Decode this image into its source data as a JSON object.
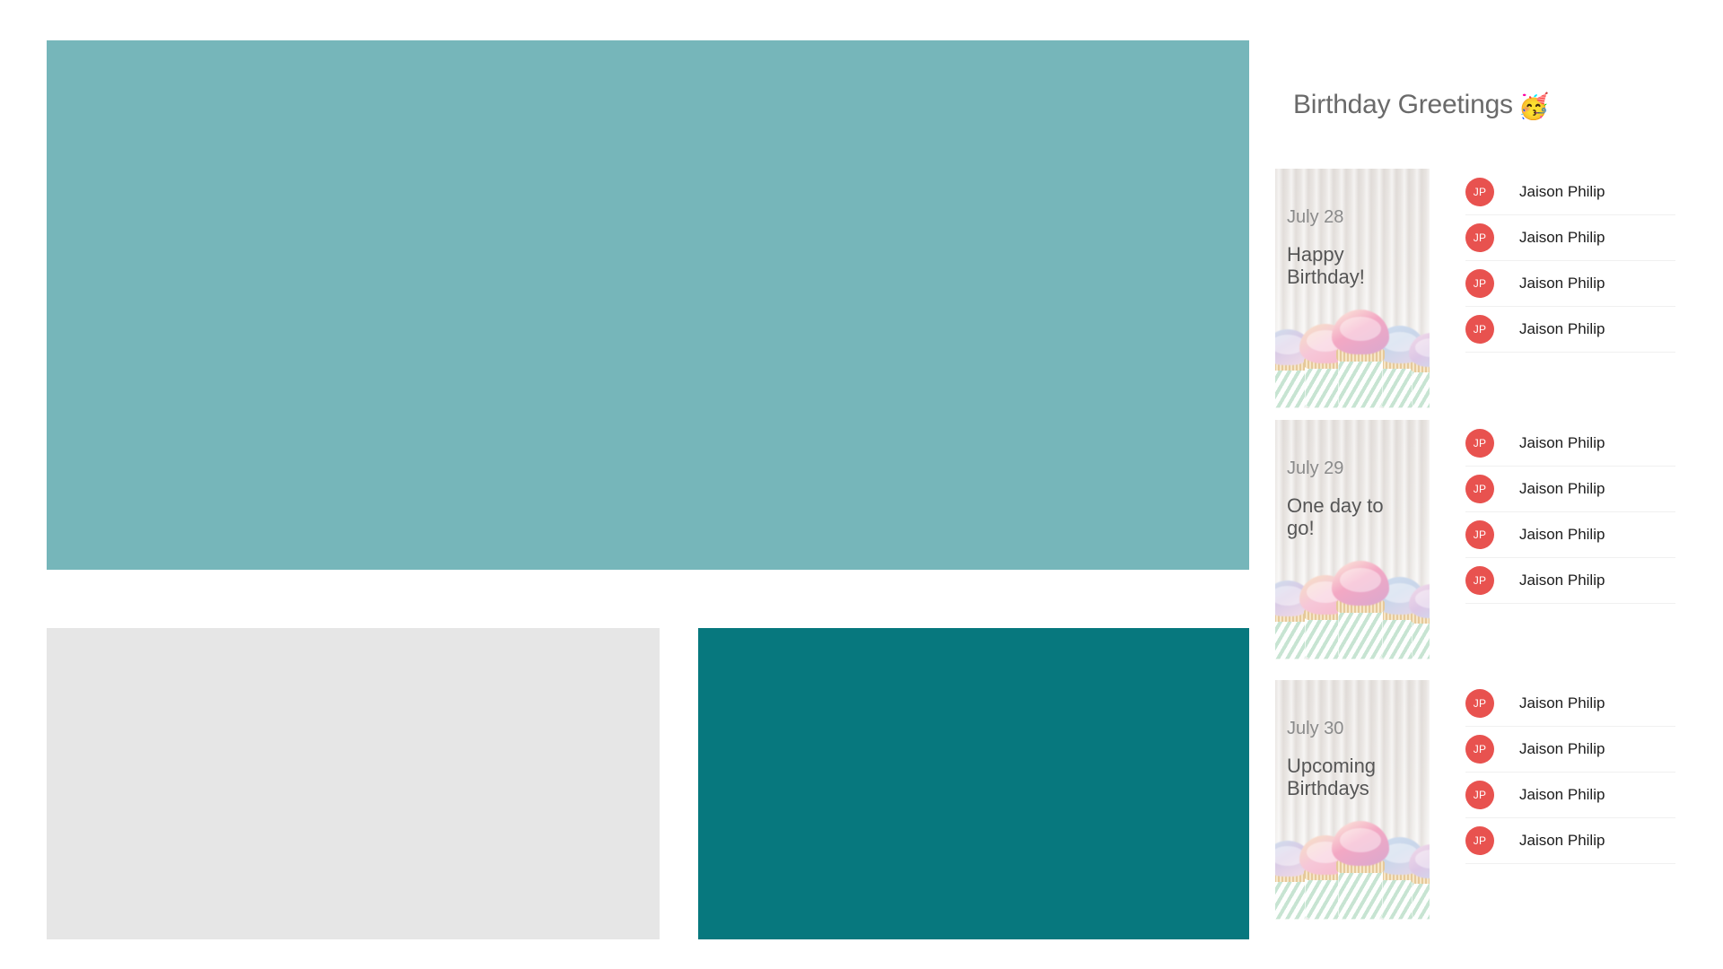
{
  "panel": {
    "title": "Birthday Greetings",
    "title_emoji": "🥳"
  },
  "blocks": [
    {
      "name": "hero-banner",
      "color": "#76b6ba"
    },
    {
      "name": "content-placeholder",
      "color": "#e6e6e6"
    },
    {
      "name": "secondary-banner",
      "color": "#07787e"
    }
  ],
  "colors": {
    "hero_teal": "#76b6ba",
    "placeholder_gray": "#e6e6e6",
    "dark_teal": "#07787e",
    "avatar_red": "#e8524f",
    "title_gray": "#6a6a6a",
    "card_date_gray": "#8a8a8a",
    "card_title_gray": "#565656",
    "divider": "#f0f0f0"
  },
  "groups": [
    {
      "date": "July 28",
      "title": "Happy Birthday!",
      "image_alt": "cupcakes-photo",
      "attendees": [
        {
          "initials": "JP",
          "name": "Jaison Philip"
        },
        {
          "initials": "JP",
          "name": "Jaison Philip"
        },
        {
          "initials": "JP",
          "name": "Jaison Philip"
        },
        {
          "initials": "JP",
          "name": "Jaison Philip"
        }
      ]
    },
    {
      "date": "July 29",
      "title": "One day to go!",
      "image_alt": "cupcakes-photo",
      "attendees": [
        {
          "initials": "JP",
          "name": "Jaison Philip"
        },
        {
          "initials": "JP",
          "name": "Jaison Philip"
        },
        {
          "initials": "JP",
          "name": "Jaison Philip"
        },
        {
          "initials": "JP",
          "name": "Jaison Philip"
        }
      ]
    },
    {
      "date": "July 30",
      "title": "Upcoming Birthdays",
      "image_alt": "cupcakes-photo",
      "attendees": [
        {
          "initials": "JP",
          "name": "Jaison Philip"
        },
        {
          "initials": "JP",
          "name": "Jaison Philip"
        },
        {
          "initials": "JP",
          "name": "Jaison Philip"
        },
        {
          "initials": "JP",
          "name": "Jaison Philip"
        }
      ]
    }
  ]
}
